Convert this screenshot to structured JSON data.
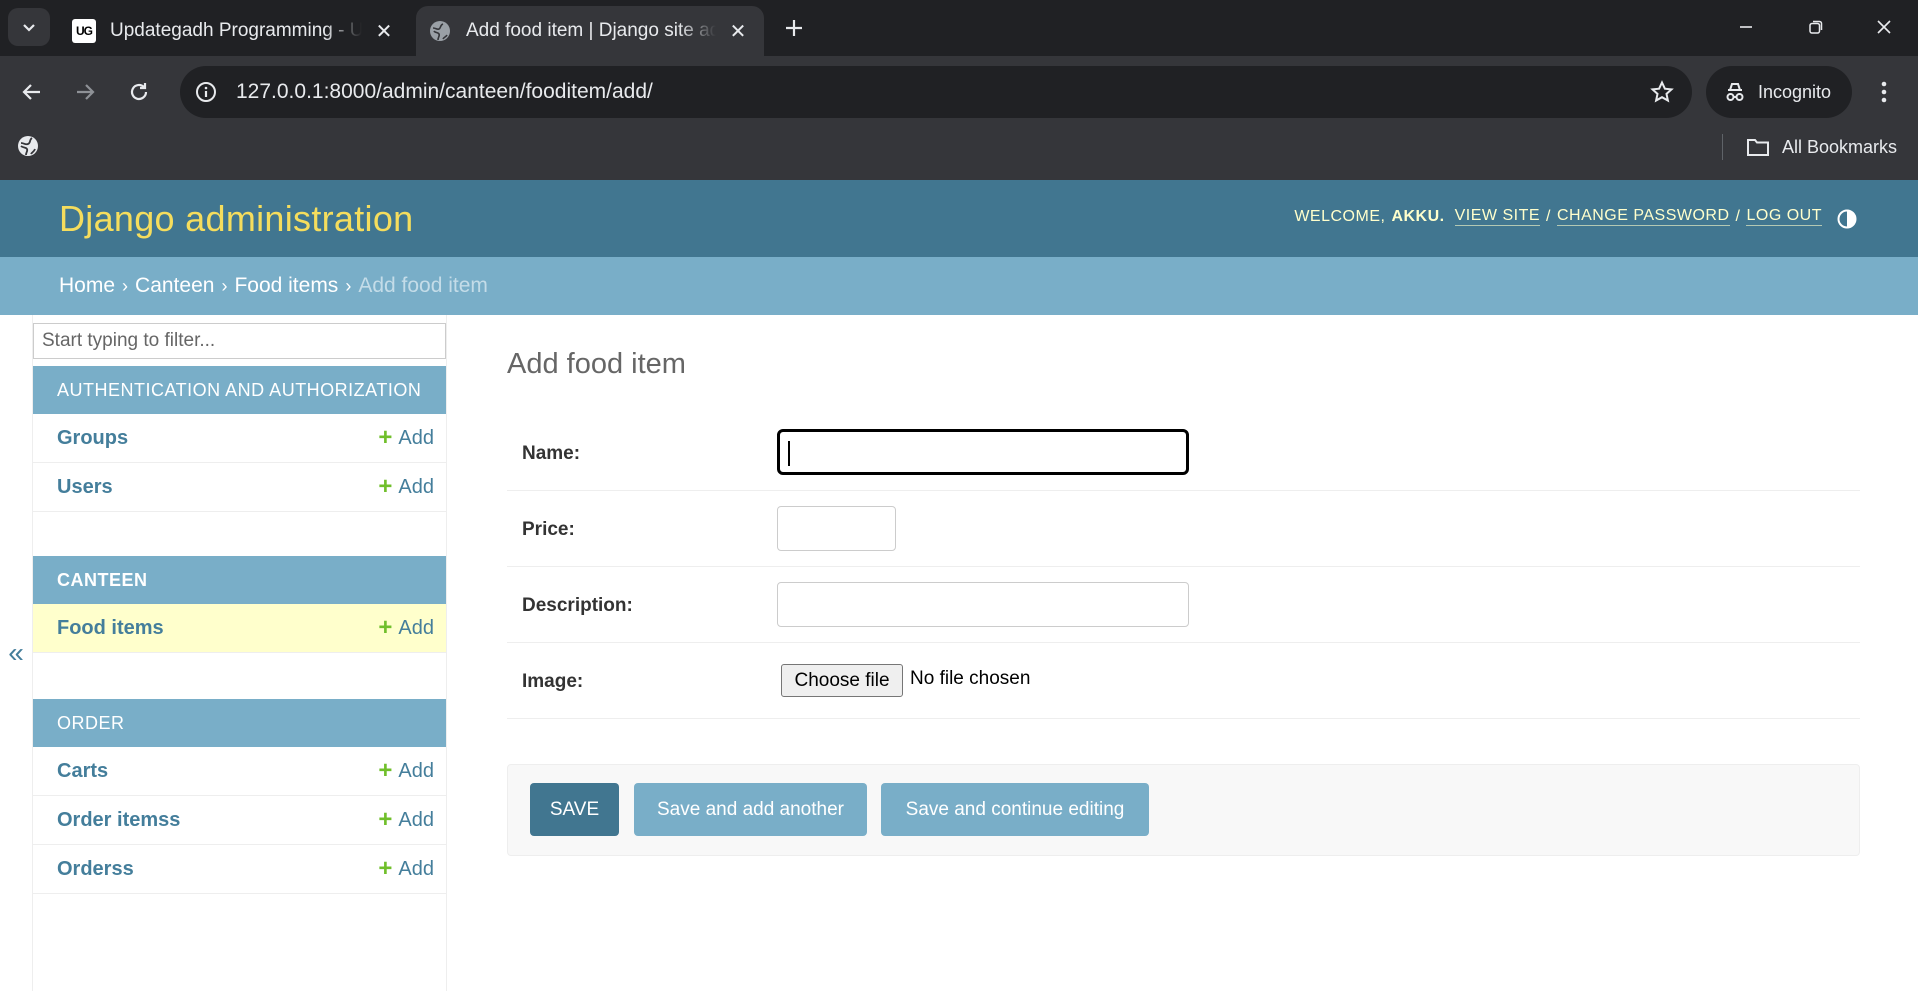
{
  "browser": {
    "tabs": [
      {
        "title": "Updategadh Programming - Updategadh",
        "favicon_text": "UG",
        "active": false
      },
      {
        "title": "Add food item | Django site admin",
        "active": true
      }
    ],
    "address_bar": {
      "url_host": "127.0.0.1",
      "url_rest": ":8000/admin/canteen/fooditem/add/"
    },
    "profile_label": "Incognito",
    "bookmarks_label": "All Bookmarks"
  },
  "admin": {
    "branding": "Django administration",
    "user_tools": {
      "welcome": "WELCOME,",
      "user_name": "AKKU.",
      "view_site": "VIEW SITE",
      "change_password": "CHANGE PASSWORD",
      "log_out": "LOG OUT",
      "separator": "/"
    },
    "breadcrumbs": {
      "home": "Home",
      "app": "Canteen",
      "model": "Food items",
      "current": "Add food item",
      "arrow": "›"
    },
    "sidebar": {
      "filter_placeholder": "Start typing to filter...",
      "toggle_label": "«",
      "add_label": "Add",
      "modules": [
        {
          "caption": "AUTHENTICATION AND AUTHORIZATION",
          "models": [
            {
              "name": "Groups"
            },
            {
              "name": "Users"
            }
          ]
        },
        {
          "caption": "CANTEEN",
          "models": [
            {
              "name": "Food items",
              "current": true
            }
          ]
        },
        {
          "caption": "ORDER",
          "models": [
            {
              "name": "Carts"
            },
            {
              "name": "Order itemss"
            },
            {
              "name": "Orderss"
            }
          ]
        }
      ]
    },
    "form": {
      "title": "Add food item",
      "fields": {
        "name": {
          "label": "Name:",
          "value": ""
        },
        "price": {
          "label": "Price:",
          "value": ""
        },
        "description": {
          "label": "Description:",
          "value": ""
        },
        "image": {
          "label": "Image:",
          "button": "Choose file",
          "status": "No file chosen"
        }
      },
      "buttons": {
        "save": "SAVE",
        "save_add_another": "Save and add another",
        "save_continue": "Save and continue editing"
      }
    }
  },
  "colors": {
    "header_bg": "#417690",
    "branding": "#f5dd5d",
    "breadcrumbs_bg": "#79aec8",
    "link": "#447e9b",
    "add_plus": "#70bf2b",
    "current_row": "#ffffcc"
  },
  "icons": [
    "tab-list-icon",
    "new-tab-icon",
    "minimize-icon",
    "restore-icon",
    "close-window-icon",
    "back-icon",
    "forward-icon",
    "reload-icon",
    "site-info-icon",
    "bookmark-star-icon",
    "incognito-icon",
    "menu-kebab-icon",
    "globe-icon",
    "folder-icon",
    "theme-toggle-icon"
  ]
}
